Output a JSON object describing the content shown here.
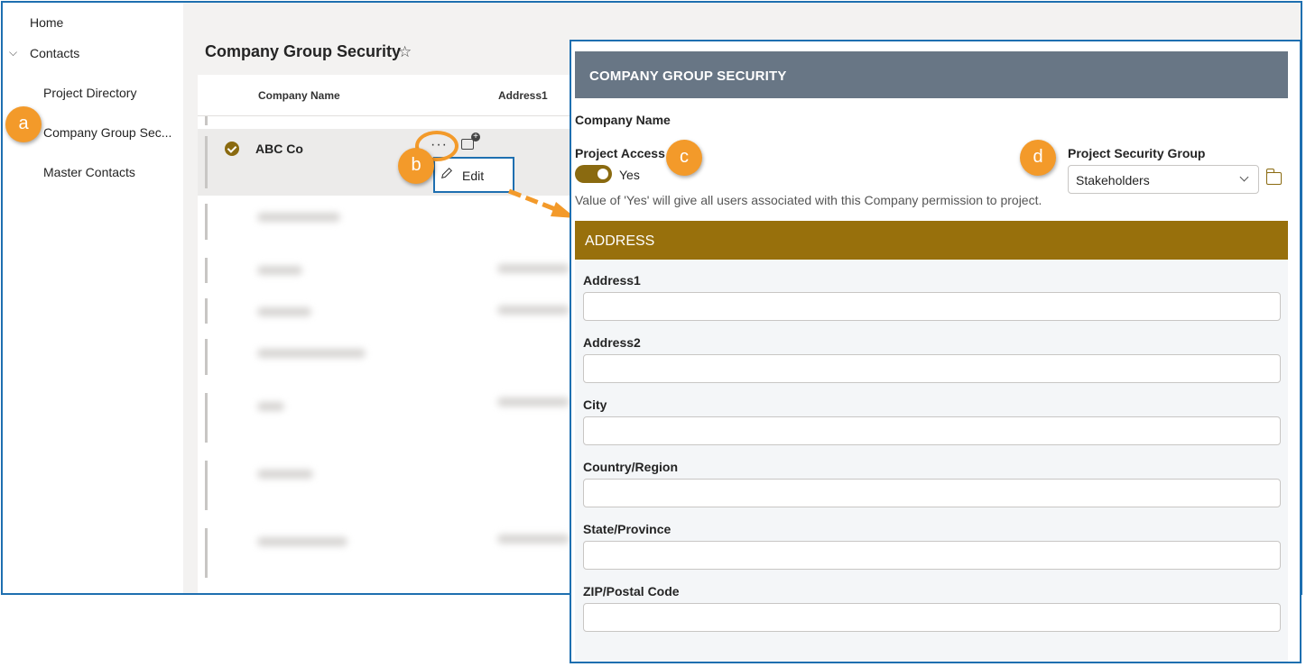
{
  "sidebar": {
    "items": [
      {
        "label": "Home"
      },
      {
        "label": "Contacts"
      },
      {
        "label": "Project Directory"
      },
      {
        "label": "Company Group Sec..."
      },
      {
        "label": "Master Contacts"
      }
    ]
  },
  "main": {
    "title": "Company Group Security",
    "columns": [
      "Company Name",
      "Address1"
    ],
    "selected_row": {
      "company_name": "ABC Co"
    },
    "context_menu": {
      "edit_label": "Edit"
    }
  },
  "callouts": [
    "a",
    "b",
    "c",
    "d"
  ],
  "panel": {
    "title": "COMPANY GROUP SECURITY",
    "company_name_label": "Company Name",
    "project_access_label": "Project Access",
    "project_access_value": "Yes",
    "project_access_on": true,
    "project_access_help": "Value of 'Yes' will give all users associated with this Company permission to project.",
    "security_group_label": "Project Security Group",
    "security_group_value": "Stakeholders",
    "address_section_title": "ADDRESS",
    "fields": [
      {
        "label": "Address1",
        "value": ""
      },
      {
        "label": "Address2",
        "value": ""
      },
      {
        "label": "City",
        "value": ""
      },
      {
        "label": "Country/Region",
        "value": ""
      },
      {
        "label": "State/Province",
        "value": ""
      },
      {
        "label": "ZIP/Postal Code",
        "value": ""
      }
    ]
  },
  "colors": {
    "accent_brown": "#8a6a10",
    "section_header": "#98700c",
    "panel_header": "#687685",
    "callout_orange": "#f39a2a",
    "frame_blue": "#1e6fb0"
  },
  "icons": [
    "chevron-down-icon",
    "star-icon",
    "check-icon",
    "more-icon",
    "comment-add-icon",
    "pencil-icon",
    "folder-icon",
    "arrow-icon"
  ]
}
